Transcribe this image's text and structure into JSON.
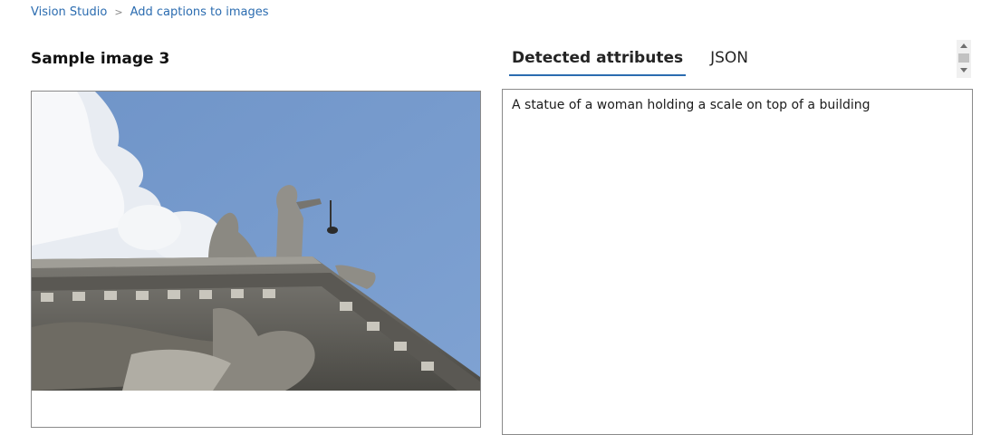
{
  "breadcrumb": {
    "root": "Vision Studio",
    "separator": ">",
    "current": "Add captions to images"
  },
  "sample": {
    "title": "Sample image 3"
  },
  "tabs": [
    {
      "label": "Detected attributes",
      "active": true
    },
    {
      "label": "JSON",
      "active": false
    }
  ],
  "result": {
    "caption": "A statue of a woman holding a scale on top of a building"
  },
  "colors": {
    "link": "#2b6cb0",
    "tab_underline": "#2b6cb0",
    "border": "#8a8a8a",
    "sky": "#7a9fd0"
  },
  "icons": {
    "scroll_up": "chevron-up-icon",
    "scroll_down": "chevron-down-icon"
  }
}
